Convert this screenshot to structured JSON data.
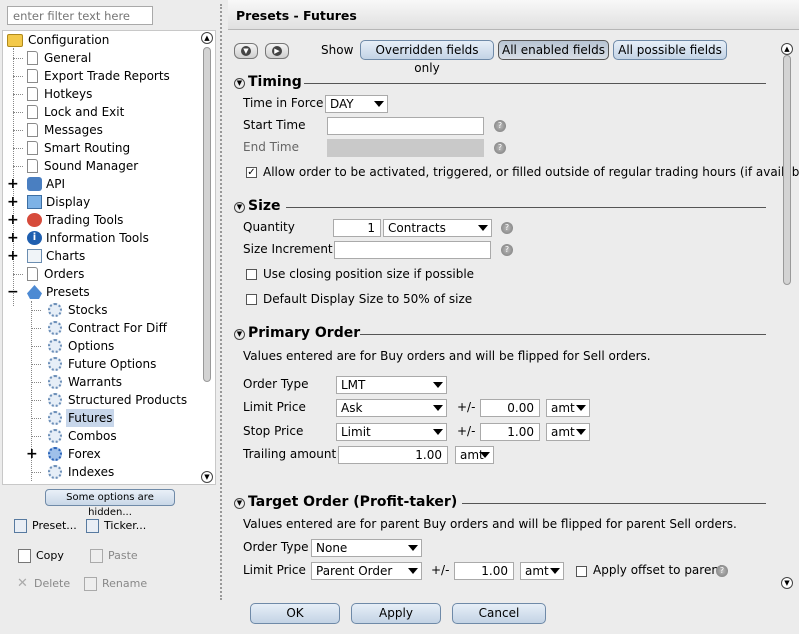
{
  "filter": {
    "placeholder": "enter filter text here"
  },
  "tree": [
    {
      "label": "Configuration",
      "icon": "folder-open-icon"
    },
    {
      "label": "General",
      "icon": "document-icon"
    },
    {
      "label": "Export Trade Reports",
      "icon": "document-icon"
    },
    {
      "label": "Hotkeys",
      "icon": "document-icon"
    },
    {
      "label": "Lock and Exit",
      "icon": "document-icon"
    },
    {
      "label": "Messages",
      "icon": "document-icon"
    },
    {
      "label": "Smart Routing",
      "icon": "document-icon"
    },
    {
      "label": "Sound Manager",
      "icon": "document-icon"
    },
    {
      "label": "API",
      "icon": "api-icon"
    },
    {
      "label": "Display",
      "icon": "display-icon"
    },
    {
      "label": "Trading Tools",
      "icon": "trading-tools-icon"
    },
    {
      "label": "Information Tools",
      "icon": "info-icon"
    },
    {
      "label": "Charts",
      "icon": "chart-icon"
    },
    {
      "label": "Orders",
      "icon": "document-icon"
    },
    {
      "label": "Presets",
      "icon": "presets-icon"
    },
    {
      "label": "Stocks",
      "icon": "gear-icon"
    },
    {
      "label": "Contract For Diff",
      "icon": "gear-icon"
    },
    {
      "label": "Options",
      "icon": "gear-icon"
    },
    {
      "label": "Future Options",
      "icon": "gear-icon"
    },
    {
      "label": "Warrants",
      "icon": "gear-icon"
    },
    {
      "label": "Structured Products",
      "icon": "gear-icon"
    },
    {
      "label": "Futures",
      "icon": "gear-icon"
    },
    {
      "label": "Combos",
      "icon": "gear-icon"
    },
    {
      "label": "Forex",
      "icon": "gear-icon"
    },
    {
      "label": "Indexes",
      "icon": "gear-icon"
    }
  ],
  "left_buttons": {
    "hidden": "Some options are hidden...",
    "preset": "Preset...",
    "ticker": "Ticker...",
    "copy": "Copy",
    "paste": "Paste",
    "delete": "Delete",
    "rename": "Rename"
  },
  "header": {
    "title": "Presets - Futures"
  },
  "show": {
    "label": "Show",
    "overridden": "Overridden fields only",
    "enabled": "All enabled fields",
    "possible": "All possible fields"
  },
  "timing": {
    "title": "Timing",
    "tif_label": "Time in Force",
    "tif_value": "DAY",
    "start_label": "Start Time",
    "start_value": "",
    "end_label": "End Time",
    "outside_rth": "Allow order to be activated, triggered, or filled outside of regular trading hours (if available)"
  },
  "size": {
    "title": "Size",
    "qty_label": "Quantity",
    "qty_value": "1",
    "unit": "Contracts",
    "increment_label": "Size Increment",
    "increment_value": "",
    "closing": "Use closing position size if possible",
    "default_display": "Default Display Size to 50% of size"
  },
  "primary": {
    "title": "Primary Order",
    "note": "Values entered are for Buy orders and will be flipped for Sell orders.",
    "order_type_label": "Order Type",
    "order_type": "LMT",
    "limit_label": "Limit Price",
    "limit_base": "Ask",
    "pm": "+/-",
    "limit_offset": "0.00",
    "limit_unit": "amt",
    "stop_label": "Stop Price",
    "stop_base": "Limit",
    "stop_offset": "1.00",
    "stop_unit": "amt",
    "trail_label": "Trailing amount",
    "trail_value": "1.00",
    "trail_unit": "amt"
  },
  "target": {
    "title": "Target Order (Profit-taker)",
    "note": "Values entered are for parent Buy orders and will be flipped for parent Sell orders.",
    "order_type_label": "Order Type",
    "order_type": "None",
    "limit_label": "Limit Price",
    "limit_base": "Parent Order",
    "pm": "+/-",
    "limit_offset": "1.00",
    "limit_unit": "amt",
    "apply_parent": "Apply offset to parent"
  },
  "footer": {
    "ok": "OK",
    "apply": "Apply",
    "cancel": "Cancel"
  }
}
